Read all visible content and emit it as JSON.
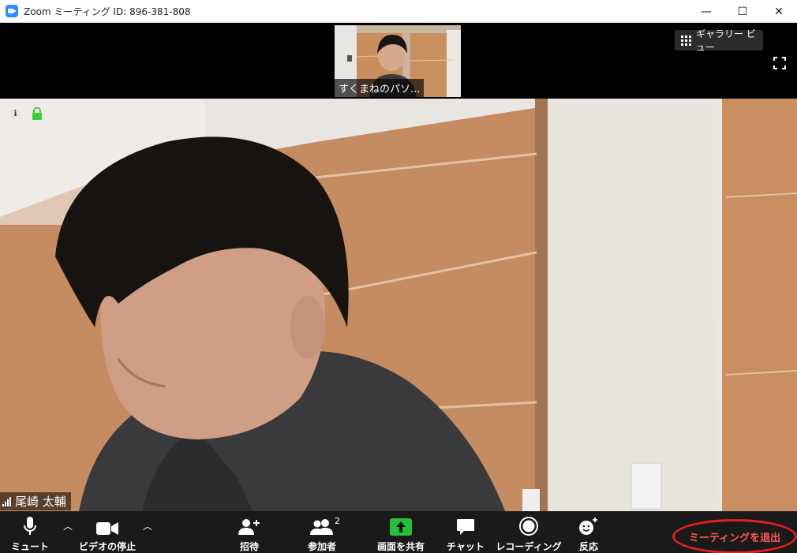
{
  "window": {
    "title": "Zoom ミーティング ID: 896-381-808",
    "minimize": "—",
    "maximize": "☐",
    "close": "✕"
  },
  "top_strip": {
    "thumbnail_name": "すくまねのパソ...",
    "gallery_view": "ギャラリー ビュー"
  },
  "main_video": {
    "info": "i",
    "speaker_name": "尾崎 太輔"
  },
  "toolbar": {
    "mute": "ミュート",
    "stop_video": "ビデオの停止",
    "invite": "招待",
    "participants": "参加者",
    "participants_count": "2",
    "share_screen": "画面を共有",
    "chat": "チャット",
    "recording": "レコーディング",
    "reactions": "反応",
    "leave_meeting": "ミーティングを退出"
  },
  "colors": {
    "toolbar_bg": "#1a1a1a",
    "share_green": "#23c13a",
    "leave_red": "#ff5a4f",
    "highlight_ring": "#e02020",
    "zoom_blue": "#2d8cff",
    "lock_green": "#3ccd3c"
  }
}
